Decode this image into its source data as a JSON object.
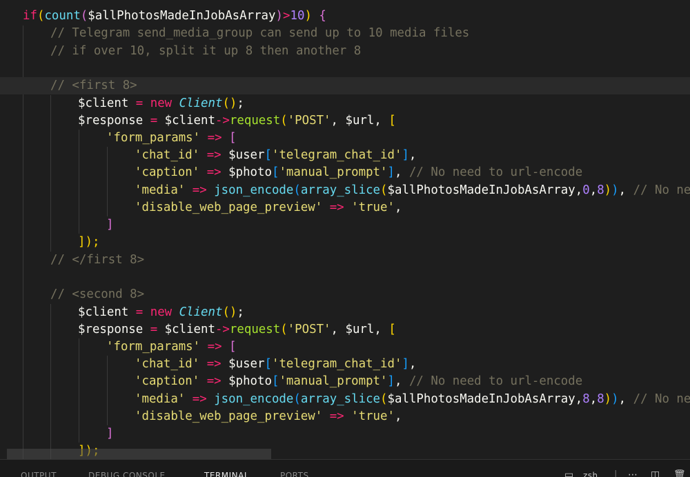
{
  "code": {
    "l1_if": "if",
    "l1_open": "(",
    "l1_count": "count",
    "l1_open2": "(",
    "l1_var": "$allPhotosMadeInJobAsArray",
    "l1_close2": ")",
    "l1_gt": ">",
    "l1_num": "10",
    "l1_close": ")",
    "l1_brace": " {",
    "l2": "// Telegram send_media_group can send up to 10 media files",
    "l3": "// if over 10, split it up 8 then another 8",
    "l5": "// <first 8>",
    "client_var": "$client",
    "eq": " = ",
    "new_kw": "new",
    "client_cls": "Client",
    "parens": "()",
    "semi": ";",
    "response_var": "$response",
    "arrow": "->",
    "request_fn": "request",
    "post_str": "'POST'",
    "url_var": "$url",
    "comma_sp": ", ",
    "bracket_open": "[",
    "form_params": "'form_params'",
    "fat_arrow": " => ",
    "chat_id": "'chat_id'",
    "user_var": "$user",
    "tg_chat_id": "'telegram_chat_id'",
    "bracket_close": "]",
    "comma": ",",
    "caption": "'caption'",
    "photo_var": "$photo",
    "manual_prompt": "'manual_prompt'",
    "cmt_url": "// No need to url-encode",
    "media": "'media'",
    "json_encode": "json_encode",
    "array_slice": "array_slice",
    "photos_var": "$allPhotosMadeInJobAsArray",
    "zero": "0",
    "eight": "8",
    "cmt_noneed": "// No need",
    "disable_preview": "'disable_web_page_preview'",
    "true_str": "'true'",
    "end_arr": "]);",
    "l15": "// </first 8>",
    "l17": "// <second 8>"
  },
  "panel": {
    "tabs": [
      "OUTPUT",
      "DEBUG CONSOLE",
      "TERMINAL",
      "PORTS"
    ],
    "active_tab": "TERMINAL",
    "shell_label": "zsh"
  },
  "colors": {
    "background": "#1e1e1e",
    "keyword": "#f92672",
    "function": "#66d9ef",
    "method": "#a6e22e",
    "string": "#e6db74",
    "comment": "#75715e",
    "number": "#ae81ff"
  }
}
